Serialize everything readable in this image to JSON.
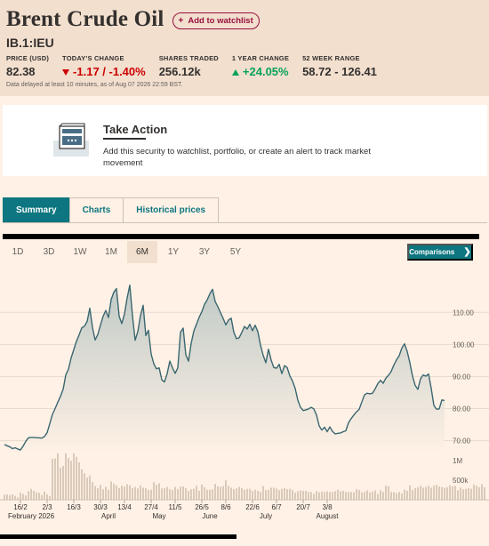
{
  "header": {
    "title": "Brent Crude Oil",
    "watchlist_label": "Add to watchlist",
    "symbol": "IB.1:IEU",
    "stats": [
      {
        "label": "PRICE (USD)",
        "value": "82.38"
      },
      {
        "label": "TODAY'S CHANGE",
        "value": "-1.17 / -1.40%"
      },
      {
        "label": "SHARES TRADED",
        "value": "256.12k"
      },
      {
        "label": "1 YEAR CHANGE",
        "value": "+24.05%"
      },
      {
        "label": "52 WEEK RANGE",
        "value": "58.72 - 126.41"
      }
    ],
    "delay_note": "Data delayed at least 10 minutes, as of Aug 07 2026 22:59 BST."
  },
  "take_action": {
    "title": "Take Action",
    "text": "Add this security to watchlist, portfolio, or create an alert to track market movement"
  },
  "tabs": [
    {
      "label": "Summary",
      "active": true
    },
    {
      "label": "Charts",
      "active": false
    },
    {
      "label": "Historical prices",
      "active": false
    }
  ],
  "periods": [
    {
      "label": "1D",
      "active": false
    },
    {
      "label": "3D",
      "active": false
    },
    {
      "label": "1W",
      "active": false
    },
    {
      "label": "1M",
      "active": false
    },
    {
      "label": "6M",
      "active": true
    },
    {
      "label": "1Y",
      "active": false
    },
    {
      "label": "3Y",
      "active": false
    },
    {
      "label": "5Y",
      "active": false
    }
  ],
  "comparisons_label": "Comparisons",
  "colors": {
    "accent": "#0d7680",
    "negative": "#cc0000",
    "positive": "#09a25a",
    "claret": "#990f3d",
    "line": "#3a6670"
  },
  "chart_data": {
    "type": "area",
    "ylim": [
      66,
      122
    ],
    "y_ticks": [
      70,
      80,
      90,
      100,
      110
    ],
    "y_tick_labels": [
      "70.00",
      "80.00",
      "90.00",
      "100.00",
      "110.00"
    ],
    "volume_tick_labels": [
      "1M",
      "500k"
    ],
    "volume_ticks": [
      1000000,
      500000
    ],
    "volume_max": 1300000,
    "x_tick_labels": [
      "16/2",
      "2/3",
      "16/3",
      "30/3",
      "13/4",
      "27/4",
      "11/5",
      "26/5",
      "8/6",
      "22/6",
      "6/7",
      "20/7",
      "3/8"
    ],
    "x_tick_index": [
      6,
      16,
      26,
      36,
      45,
      55,
      64,
      74,
      83,
      93,
      102,
      112,
      121
    ],
    "month_labels": [
      {
        "label": "February 2026",
        "index": 10
      },
      {
        "label": "April",
        "index": 39
      },
      {
        "label": "May",
        "index": 58
      },
      {
        "label": "June",
        "index": 77
      },
      {
        "label": "July",
        "index": 98
      },
      {
        "label": "August",
        "index": 121
      }
    ],
    "price": [
      68.8,
      68.4,
      68.1,
      67.5,
      67.8,
      67.4,
      67.1,
      68.3,
      69.8,
      70.9,
      71.0,
      71.0,
      70.9,
      70.9,
      70.8,
      71.3,
      72.5,
      75.3,
      78.2,
      80.0,
      82.0,
      83.8,
      86.0,
      90.5,
      92.3,
      95.8,
      98.4,
      101.0,
      103.0,
      105.2,
      105.7,
      107.2,
      111.3,
      105.3,
      101.4,
      103.1,
      106.0,
      108.8,
      110.6,
      108.4,
      114.0,
      116.3,
      117.4,
      108.8,
      106.5,
      109.5,
      114.5,
      118.5,
      109.0,
      101.3,
      104.0,
      109.0,
      112.2,
      102.8,
      104.4,
      97.0,
      94.0,
      92.4,
      92.7,
      89.0,
      88.3,
      90.9,
      94.8,
      92.7,
      91.0,
      92.7,
      103.8,
      105.1,
      96.8,
      94.8,
      100.3,
      104.2,
      106.3,
      108.5,
      110.2,
      112.5,
      113.9,
      115.8,
      117.2,
      113.4,
      111.8,
      109.9,
      108.1,
      106.1,
      107.6,
      108.2,
      103.8,
      101.8,
      102.1,
      103.8,
      105.6,
      104.8,
      106.3,
      104.3,
      106.0,
      104.0,
      99.8,
      96.6,
      94.3,
      98.5,
      95.1,
      92.8,
      92.6,
      93.8,
      90.9,
      93.4,
      92.8,
      90.2,
      88.6,
      86.3,
      82.6,
      80.4,
      79.4,
      79.6,
      79.9,
      80.4,
      79.9,
      78.0,
      74.6,
      73.3,
      74.2,
      72.8,
      74.3,
      72.9,
      72.1,
      72.3,
      72.4,
      72.8,
      73.1,
      75.6,
      76.9,
      78.0,
      79.0,
      79.8,
      82.1,
      84.3,
      84.8,
      84.6,
      84.8,
      86.2,
      87.8,
      88.8,
      87.9,
      89.5,
      90.4,
      91.6,
      93.6,
      95.2,
      96.5,
      98.9,
      100.2,
      97.8,
      94.3,
      90.1,
      87.2,
      86.0,
      89.3,
      90.5,
      90.1,
      90.8,
      86.3,
      81.0,
      79.8,
      79.9,
      82.7,
      82.5
    ],
    "volume": [
      130000,
      140000,
      120000,
      140000,
      100000,
      60000,
      180000,
      150000,
      110000,
      220000,
      280000,
      230000,
      190000,
      180000,
      120000,
      210000,
      140000,
      100000,
      1050000,
      1060000,
      1220000,
      820000,
      870000,
      1230000,
      1070000,
      1000000,
      1210000,
      1100000,
      960000,
      780000,
      680000,
      570000,
      620000,
      450000,
      350000,
      300000,
      380000,
      270000,
      330000,
      260000,
      470000,
      410000,
      370000,
      300000,
      360000,
      340000,
      400000,
      370000,
      300000,
      330000,
      290000,
      370000,
      310000,
      300000,
      250000,
      260000,
      450000,
      380000,
      420000,
      290000,
      300000,
      330000,
      270000,
      250000,
      330000,
      270000,
      340000,
      340000,
      300000,
      230000,
      270000,
      280000,
      360000,
      230000,
      390000,
      320000,
      260000,
      260000,
      270000,
      410000,
      340000,
      330000,
      350000,
      500000,
      360000,
      310000,
      270000,
      290000,
      330000,
      300000,
      260000,
      280000,
      280000,
      230000,
      260000,
      230000,
      210000,
      350000,
      250000,
      260000,
      310000,
      310000,
      290000,
      250000,
      280000,
      300000,
      270000,
      280000,
      250000,
      180000,
      220000,
      240000,
      230000,
      230000,
      200000,
      200000,
      150000,
      220000,
      190000,
      210000,
      200000,
      220000,
      200000,
      200000,
      220000,
      260000,
      220000,
      230000,
      200000,
      200000,
      200000,
      190000,
      270000,
      250000,
      190000,
      200000,
      240000,
      190000,
      210000,
      240000,
      150000,
      240000,
      200000,
      360000,
      350000,
      200000,
      200000,
      170000,
      200000,
      160000,
      260000,
      230000,
      370000,
      250000,
      300000,
      320000,
      360000,
      310000,
      330000,
      360000,
      310000,
      360000,
      380000,
      340000,
      330000,
      310000,
      320000,
      370000,
      350000,
      360000,
      240000,
      310000,
      270000,
      280000,
      300000,
      280000,
      390000,
      360000,
      320000,
      400000,
      320000
    ]
  }
}
